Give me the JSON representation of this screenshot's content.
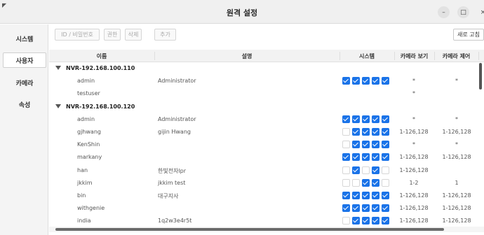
{
  "window": {
    "title": "원격 설정",
    "corner_mark": "◤",
    "minimize_glyph": "–",
    "maximize_glyph": "□",
    "close_glyph": "×"
  },
  "sidebar": {
    "items": [
      {
        "label": "시스템",
        "active": false
      },
      {
        "label": "사용자",
        "active": true
      },
      {
        "label": "카메라",
        "active": false
      },
      {
        "label": "속성",
        "active": false
      }
    ]
  },
  "toolbar": {
    "id_password_label": "ID / 비밀번호",
    "permission_label": "권한",
    "delete_label": "삭제",
    "add_label": "추가",
    "refresh_label": "새로 고침"
  },
  "table": {
    "columns": {
      "name": "이름",
      "description": "설명",
      "system": "시스템",
      "camera_view": "카메라 보기",
      "camera_control": "카메라 제어"
    },
    "rows": [
      {
        "type": "group",
        "name": "NVR-192.168.100.110"
      },
      {
        "type": "user",
        "name": "admin",
        "description": "Administrator",
        "checks": [
          1,
          1,
          1,
          1,
          1
        ],
        "view": "*",
        "control": "*"
      },
      {
        "type": "user",
        "name": "testuser",
        "description": "",
        "checks": [],
        "view": "*",
        "control": ""
      },
      {
        "type": "group",
        "name": "NVR-192.168.100.120"
      },
      {
        "type": "user",
        "name": "admin",
        "description": "Administrator",
        "checks": [
          1,
          1,
          1,
          1,
          1
        ],
        "view": "*",
        "control": "*"
      },
      {
        "type": "user",
        "name": "gjhwang",
        "description": "gijin Hwang",
        "checks": [
          0,
          1,
          1,
          1,
          1
        ],
        "view": "1-126,128",
        "control": "1-126,128"
      },
      {
        "type": "user",
        "name": "KenShin",
        "description": "",
        "checks": [
          0,
          1,
          1,
          1,
          1
        ],
        "view": "*",
        "control": "*"
      },
      {
        "type": "user",
        "name": "markany",
        "description": "",
        "checks": [
          1,
          1,
          1,
          1,
          1
        ],
        "view": "1-126,128",
        "control": "1-126,128"
      },
      {
        "type": "user",
        "name": "han",
        "description": "한빛전자lpr",
        "checks": [
          0,
          1,
          0,
          1,
          0
        ],
        "view": "1-126,128",
        "control": ""
      },
      {
        "type": "user",
        "name": "jkkim",
        "description": "jkkim test",
        "checks": [
          0,
          0,
          1,
          1,
          0
        ],
        "view": "1-2",
        "control": "1"
      },
      {
        "type": "user",
        "name": "bin",
        "description": "대구지사",
        "checks": [
          1,
          1,
          1,
          1,
          1
        ],
        "view": "1-126,128",
        "control": "1-126,128"
      },
      {
        "type": "user",
        "name": "withgenie",
        "description": "",
        "checks": [
          1,
          1,
          1,
          1,
          1
        ],
        "view": "1-126,128",
        "control": "1-126,128"
      },
      {
        "type": "user",
        "name": "india",
        "description": "1q2w3e4r5t",
        "checks": [
          0,
          1,
          1,
          1,
          1
        ],
        "view": "1-126,128",
        "control": "1-126,128"
      }
    ]
  },
  "colors": {
    "accent": "#1a73e8",
    "titlebar": "#f0f0f0",
    "sidebar": "#f4f4f4"
  }
}
